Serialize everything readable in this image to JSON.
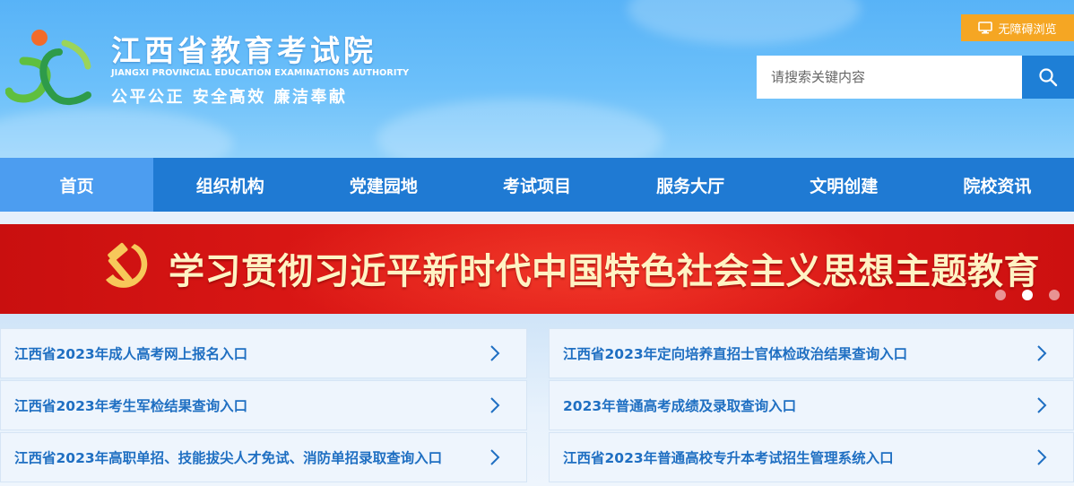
{
  "header": {
    "title": "江西省教育考试院",
    "title_en": "JIANGXI PROVINCIAL EDUCATION EXAMINATIONS AUTHORITY",
    "motto": "公平公正 安全高效 廉洁奉献",
    "accessibility_label": "无障碍浏览",
    "search": {
      "placeholder": "请搜索关键内容",
      "value": ""
    }
  },
  "nav": {
    "items": [
      {
        "label": "首页",
        "active": true
      },
      {
        "label": "组织机构"
      },
      {
        "label": "党建园地"
      },
      {
        "label": "考试项目"
      },
      {
        "label": "服务大厅"
      },
      {
        "label": "文明创建"
      },
      {
        "label": "院校资讯"
      }
    ]
  },
  "banner": {
    "text": "学习贯彻习近平新时代中国特色社会主义思想主题教育",
    "slides": 3,
    "active_slide": 2
  },
  "links": {
    "left": [
      "江西省2023年成人高考网上报名入口",
      "江西省2023年考生军检结果查询入口",
      "江西省2023年高职单招、技能拔尖人才免试、消防单招录取查询入口"
    ],
    "right": [
      "江西省2023年定向培养直招士官体检政治结果查询入口",
      "2023年普通高考成绩及录取查询入口",
      "江西省2023年普通高校专升本考试招生管理系统入口"
    ]
  },
  "colors": {
    "nav_bg": "#1f7ad3",
    "nav_active": "#4c9df0",
    "accent_orange": "#f5a623",
    "banner_red": "#e01a17",
    "link_text": "#1f6fc2"
  },
  "icons": {
    "access": "monitor-icon",
    "search": "search-icon",
    "chevron": "chevron-right-icon",
    "emblem": "hammer-sickle-icon"
  }
}
